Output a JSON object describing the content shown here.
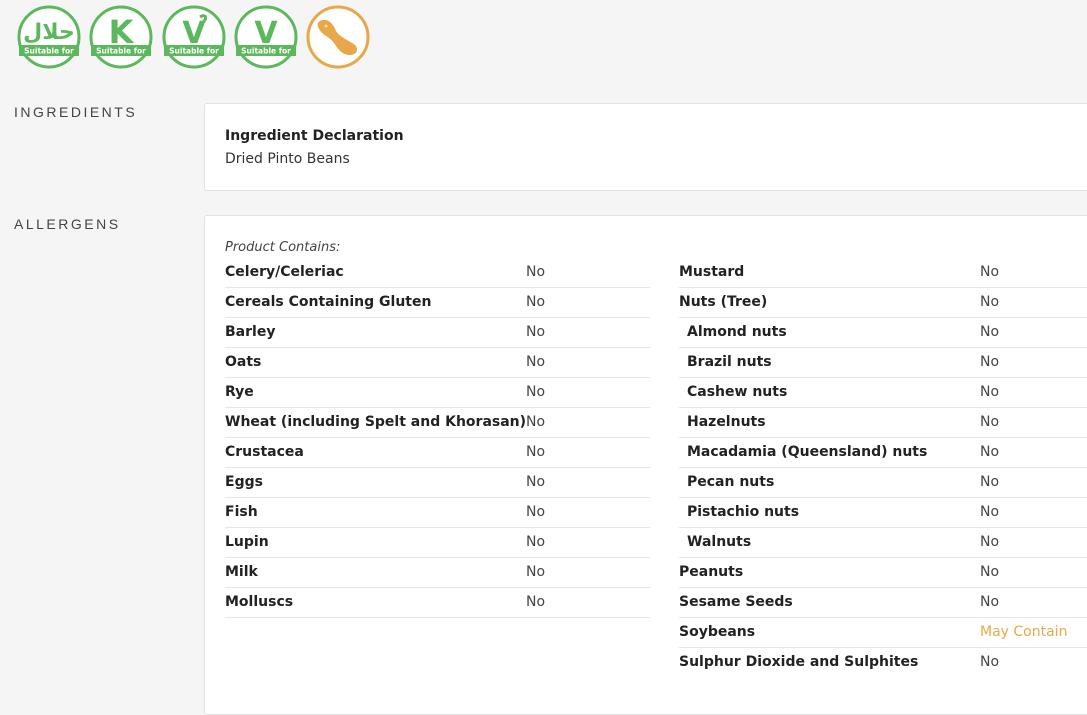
{
  "badges": [
    {
      "name": "halal",
      "caption": "Suitable for",
      "symbol": "حلال",
      "color": "#5cb85c"
    },
    {
      "name": "kosher",
      "caption": "Suitable for",
      "symbol": "K",
      "color": "#5cb85c"
    },
    {
      "name": "vegetarian",
      "caption": "Suitable for",
      "symbol": "V",
      "color": "#5cb85c"
    },
    {
      "name": "vegan",
      "caption": "Suitable for",
      "symbol": "V",
      "color": "#5cb85c"
    },
    {
      "name": "soy",
      "color": "#e8a84a"
    }
  ],
  "ingredients": {
    "label": "INGREDIENTS",
    "title": "Ingredient Declaration",
    "text": "Dried Pinto Beans"
  },
  "allergens": {
    "label": "ALLERGENS",
    "contains_label": "Product Contains:",
    "left": [
      {
        "name": "Celery/Celeriac",
        "value": "No"
      },
      {
        "name": "Cereals Containing Gluten",
        "value": "No"
      },
      {
        "name": "Barley",
        "value": "No"
      },
      {
        "name": "Oats",
        "value": "No"
      },
      {
        "name": "Rye",
        "value": "No"
      },
      {
        "name": "Wheat (including Spelt and Khorasan)",
        "value": "No"
      },
      {
        "name": "Crustacea",
        "value": "No"
      },
      {
        "name": "Eggs",
        "value": "No"
      },
      {
        "name": "Fish",
        "value": "No"
      },
      {
        "name": "Lupin",
        "value": "No"
      },
      {
        "name": "Milk",
        "value": "No"
      },
      {
        "name": "Molluscs",
        "value": "No"
      }
    ],
    "right": [
      {
        "name": "Mustard",
        "value": "No"
      },
      {
        "name": "Nuts (Tree)",
        "value": "No"
      },
      {
        "name": "Almond nuts",
        "value": "No"
      },
      {
        "name": "Brazil nuts",
        "value": "No"
      },
      {
        "name": "Cashew nuts",
        "value": "No"
      },
      {
        "name": "Hazelnuts",
        "value": "No"
      },
      {
        "name": "Macadamia (Queensland) nuts",
        "value": "No"
      },
      {
        "name": "Pecan nuts",
        "value": "No"
      },
      {
        "name": "Pistachio nuts",
        "value": "No"
      },
      {
        "name": "Walnuts",
        "value": "No"
      },
      {
        "name": "Peanuts",
        "value": "No"
      },
      {
        "name": "Sesame Seeds",
        "value": "No"
      },
      {
        "name": "Soybeans",
        "value": "May Contain"
      },
      {
        "name": "Sulphur Dioxide and Sulphites",
        "value": "No"
      }
    ]
  },
  "colors": {
    "green": "#5cb85c",
    "orange": "#e8a84a"
  }
}
